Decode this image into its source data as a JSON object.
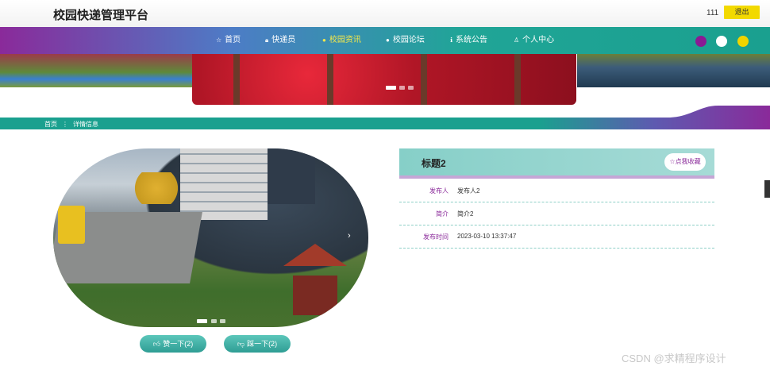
{
  "header": {
    "title": "校园快递管理平台",
    "user": "111",
    "logout_label": "退出"
  },
  "nav": [
    {
      "icon": "star-icon",
      "glyph": "☆",
      "label": "首页"
    },
    {
      "icon": "lock-icon",
      "glyph": "🔒︎",
      "label": "快递员"
    },
    {
      "icon": "dot-icon",
      "glyph": "●",
      "label": "校园资讯",
      "active": true
    },
    {
      "icon": "dot-icon",
      "glyph": "●",
      "label": "校园论坛"
    },
    {
      "icon": "info-icon",
      "glyph": "ℹ",
      "label": "系统公告"
    },
    {
      "icon": "user-icon",
      "glyph": "♙",
      "label": "个人中心"
    }
  ],
  "theme_dots": [
    "#8a1a94",
    "#ffffff",
    "#f0d400"
  ],
  "breadcrumb": {
    "home": "首页",
    "sep": "⋮",
    "current": "详情信息"
  },
  "detail": {
    "title": "标题2",
    "favorite_label": "点我收藏",
    "fields": [
      {
        "label": "发布人",
        "value": "发布人2"
      },
      {
        "label": "简介",
        "value": "简介2"
      },
      {
        "label": "发布时间",
        "value": "2023-03-10 13:37:47"
      }
    ]
  },
  "actions": {
    "like_label": "赞一下(2)",
    "dislike_label": "踩一下(2)"
  },
  "watermark": "CSDN @求精程序设计",
  "colors": {
    "accent": "#1aa08f",
    "purple": "#8a2a9a",
    "logout": "#f2d900"
  }
}
